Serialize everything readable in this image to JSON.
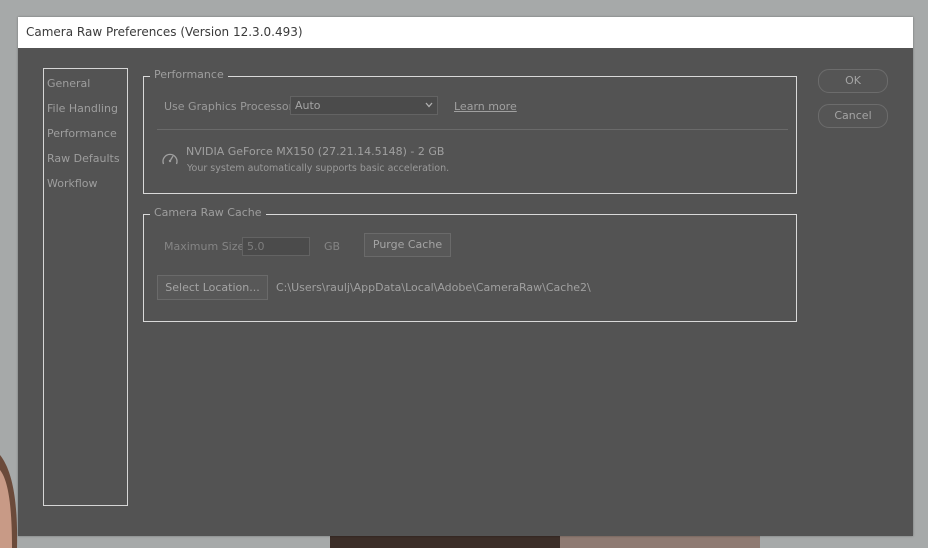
{
  "dialog": {
    "title": "Camera Raw Preferences  (Version 12.3.0.493)"
  },
  "sidebar": {
    "items": [
      {
        "label": "General"
      },
      {
        "label": "File Handling"
      },
      {
        "label": "Performance"
      },
      {
        "label": "Raw Defaults"
      },
      {
        "label": "Workflow"
      }
    ]
  },
  "performance": {
    "legend": "Performance",
    "gpu_label": "Use Graphics Processor:",
    "gpu_value": "Auto",
    "learn_more": "Learn more",
    "gpu_name": "NVIDIA GeForce MX150 (27.21.14.5148) - 2 GB",
    "gpu_status": "Your system automatically supports basic acceleration."
  },
  "cache": {
    "legend": "Camera Raw Cache",
    "max_size_label": "Maximum Size:",
    "max_size_value": "5.0",
    "unit": "GB",
    "purge_label": "Purge Cache",
    "select_location_label": "Select Location...",
    "path": "C:\\Users\\raulj\\AppData\\Local\\Adobe\\CameraRaw\\Cache2\\"
  },
  "buttons": {
    "ok": "OK",
    "cancel": "Cancel"
  },
  "icons": {
    "gpu": "gauge-icon",
    "dropdown": "chevron-down-icon"
  },
  "colors": {
    "dialog_bg": "#535353",
    "titlebar_bg": "#ffffff",
    "text": "#9e9e9e",
    "border": "#d9d9d9"
  }
}
